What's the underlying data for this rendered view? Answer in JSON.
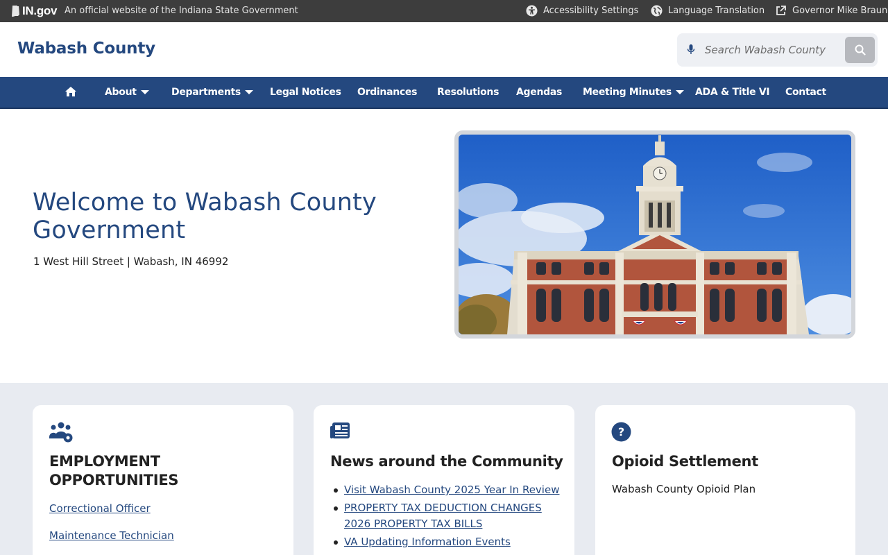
{
  "statebar": {
    "logo_text": "IN.gov",
    "official_text": "An official website of the Indiana State Government",
    "accessibility_label": "Accessibility Settings",
    "language_label": "Language Translation",
    "governor_label": "Governor Mike Braun"
  },
  "header": {
    "site_title": "Wabash County",
    "search_placeholder": "Search Wabash County",
    "search_icon": "search-icon",
    "mic_icon": "microphone-icon"
  },
  "nav": {
    "home_icon": "home-icon",
    "items": [
      {
        "label": "About",
        "dropdown": true
      },
      {
        "label": "Departments",
        "dropdown": true
      },
      {
        "label": "Legal Notices",
        "dropdown": false
      },
      {
        "label": "Ordinances",
        "dropdown": false
      },
      {
        "label": "Resolutions",
        "dropdown": false
      },
      {
        "label": "Agendas",
        "dropdown": false
      },
      {
        "label": "Meeting Minutes",
        "dropdown": true
      },
      {
        "label": "ADA & Title VI",
        "dropdown": false
      },
      {
        "label": "Contact",
        "dropdown": false
      }
    ]
  },
  "hero": {
    "title": "Welcome to Wabash County Government",
    "address": "1 West Hill Street | Wabash, IN 46992"
  },
  "cards": {
    "employment": {
      "icon": "people-gear-icon",
      "title": "EMPLOYMENT OPPORTUNITIES",
      "links": [
        "Correctional Officer",
        "Maintenance Technician"
      ]
    },
    "news": {
      "icon": "newspaper-icon",
      "title": "News around the Community",
      "items": [
        "Visit Wabash County 2025 Year In Review",
        "PROPERTY TAX DEDUCTION CHANGES 2026 PROPERTY TAX BILLS",
        "VA Updating Information Events"
      ]
    },
    "opioid": {
      "icon": "question-circle-icon",
      "title": "Opioid Settlement",
      "text": "Wabash County Opioid Plan"
    }
  },
  "colors": {
    "brand_blue": "#24487f",
    "statebar_bg": "#3d3d3d",
    "section_bg": "#e8ebf1"
  }
}
